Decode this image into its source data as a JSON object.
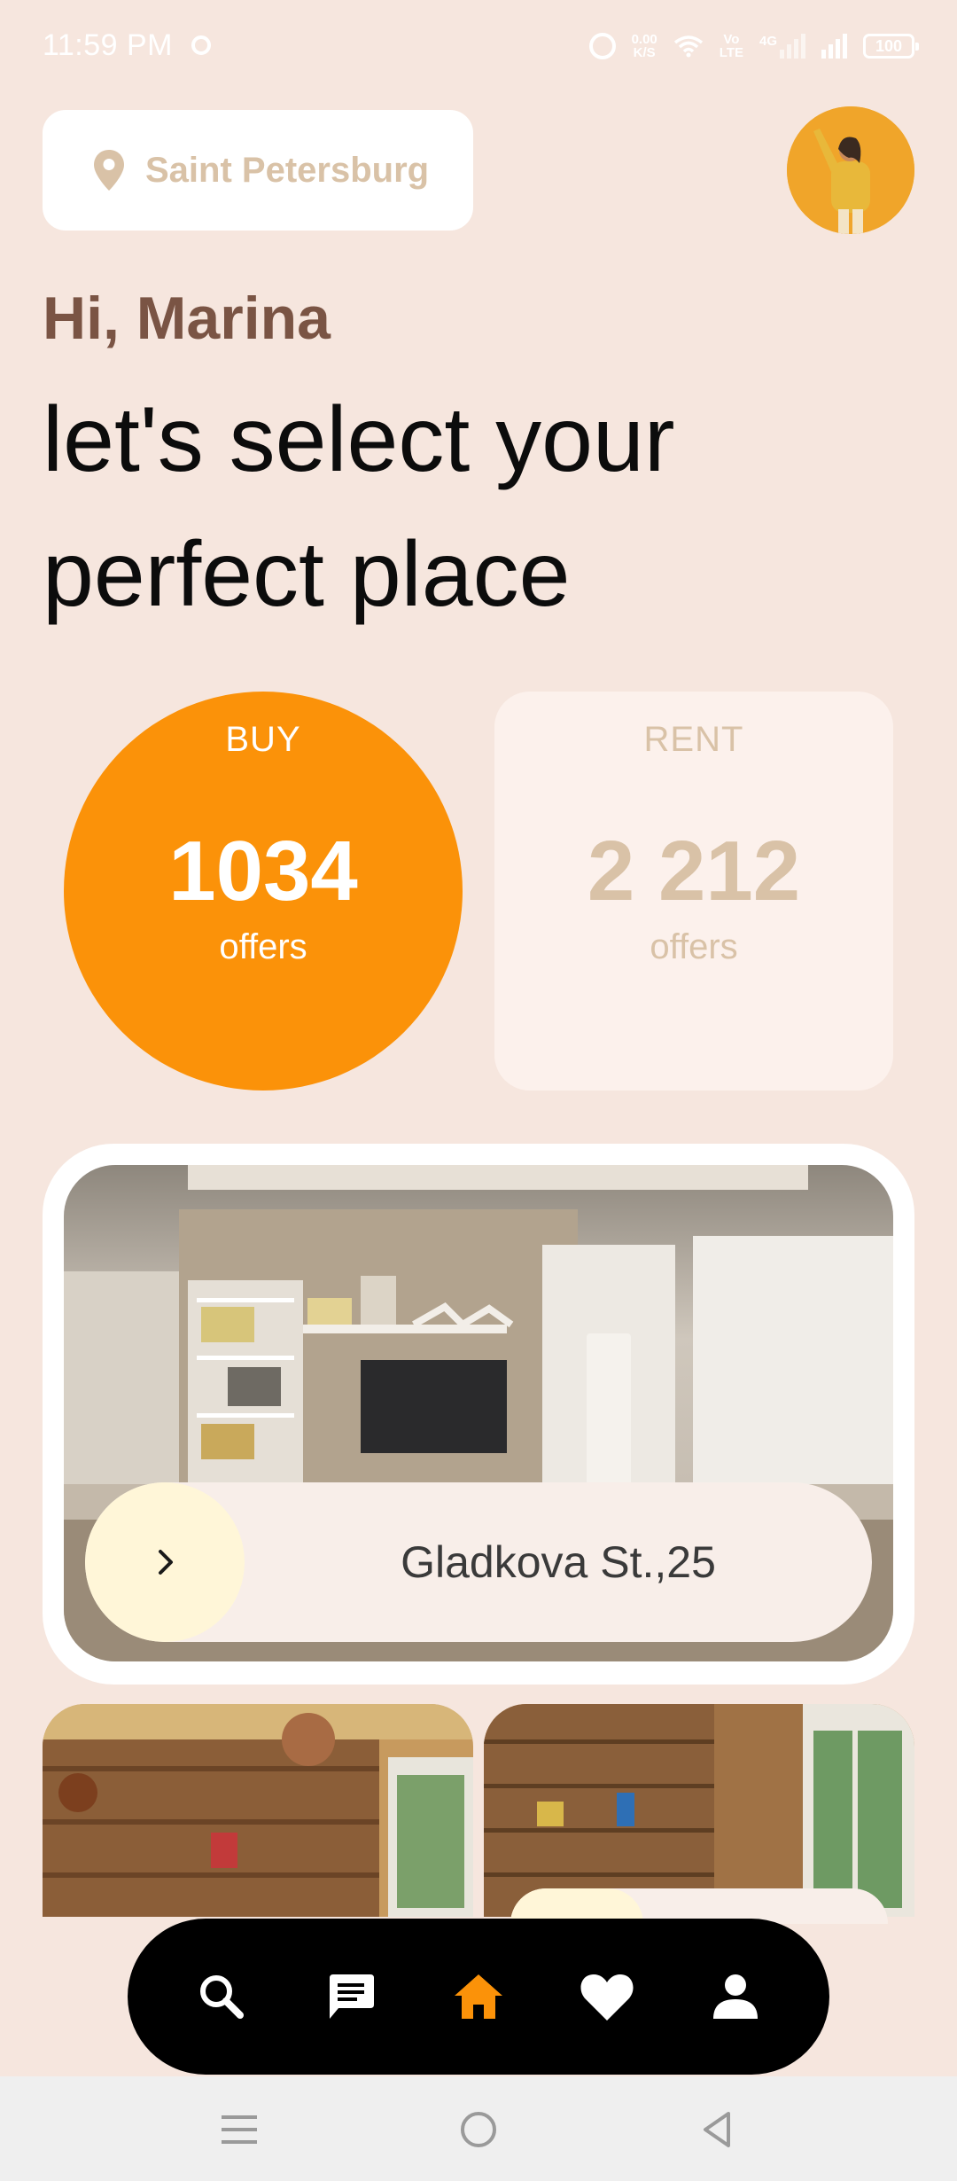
{
  "status_bar": {
    "time": "11:59 PM",
    "net_speed_value": "0.00",
    "net_speed_unit": "K/S",
    "volte_top": "Vo",
    "volte_bottom": "LTE",
    "network": "4G",
    "battery": "100"
  },
  "location": {
    "label": "Saint Petersburg",
    "icon": "map-pin-icon"
  },
  "greeting": "Hi, Marina",
  "headline": "let's select your perfect place",
  "offers": {
    "buy": {
      "kicker": "BUY",
      "count": "1034",
      "unit": "offers"
    },
    "rent": {
      "kicker": "RENT",
      "count": "2 212",
      "unit": "offers"
    }
  },
  "featured": {
    "address": "Gladkova St.,25",
    "action_icon": "chevron-right-icon"
  },
  "bottom_nav": [
    {
      "name": "search",
      "icon": "search-icon",
      "active": false
    },
    {
      "name": "messages",
      "icon": "chat-icon",
      "active": false
    },
    {
      "name": "home",
      "icon": "home-icon",
      "active": true
    },
    {
      "name": "favorites",
      "icon": "heart-icon",
      "active": false
    },
    {
      "name": "profile",
      "icon": "person-icon",
      "active": false
    }
  ],
  "colors": {
    "background": "#F6E6DE",
    "accent": "#FB9209",
    "greeting": "#7A5444",
    "muted": "#D9C2A7"
  }
}
